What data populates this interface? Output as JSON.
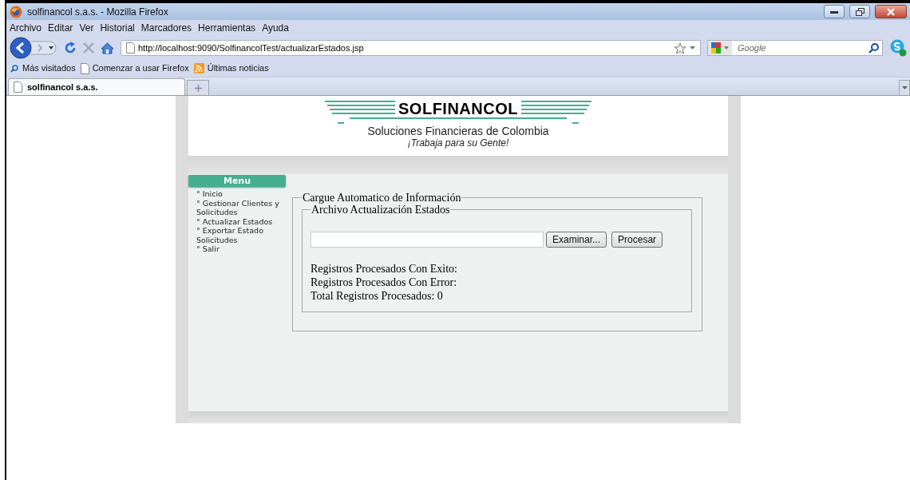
{
  "window": {
    "title": "solfinancol s.a.s. - Mozilla Firefox"
  },
  "menu_bar": [
    "Archivo",
    "Editar",
    "Ver",
    "Historial",
    "Marcadores",
    "Herramientas",
    "Ayuda"
  ],
  "address_bar": {
    "url": "http://localhost:9090/SolfinancolTest/actualizarEstados.jsp"
  },
  "search_box": {
    "placeholder": "Google"
  },
  "bookmarks": [
    {
      "kind": "search",
      "label": "Más visitados"
    },
    {
      "kind": "page",
      "label": "Comenzar a usar Firefox"
    },
    {
      "kind": "feed",
      "label": "Últimas noticias"
    }
  ],
  "tabs": [
    {
      "label": "solfinancol s.a.s.",
      "selected": true
    }
  ],
  "page": {
    "logo": {
      "name": "SOLFINANCOL",
      "subtitle": "Soluciones Financieras de Colombia",
      "slogan": "¡Trabaja para su Gente!"
    },
    "menu": {
      "title": "Menu",
      "items": [
        "° Inicio",
        "° Gestionar Clientes y Solicitudes",
        "° Actualizar Estados",
        "° Exportar Estado Solicitudes",
        "° Salir"
      ]
    },
    "form": {
      "legend": "Cargue Automatico de Información",
      "inner_legend": "Archivo Actualización Estados",
      "buttons": [
        "Examinar...",
        "Procesar"
      ],
      "results": [
        "Registros Procesados Con Exito:",
        "Registros Procesados Con Error:",
        "Total Registros Procesados: 0"
      ]
    }
  }
}
